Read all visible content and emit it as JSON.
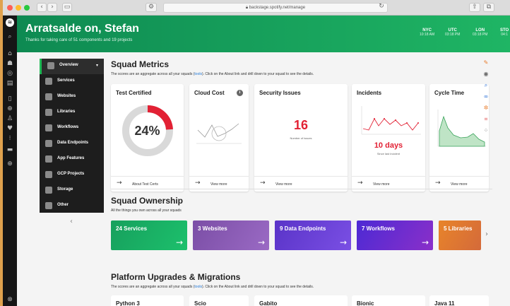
{
  "browser": {
    "url": "backstage.spotify.net/manage"
  },
  "header": {
    "title": "Arratsalde on, Stefan",
    "subtitle": "Thanks for taking care of 51 components and 19 projects",
    "clocks": [
      {
        "zone": "NYC",
        "time": "10:18 AM"
      },
      {
        "zone": "UTC",
        "time": "03:18 PM"
      },
      {
        "zone": "LON",
        "time": "03:18 PM"
      },
      {
        "zone": "STO",
        "time": "04:1"
      }
    ]
  },
  "menu": {
    "items": [
      {
        "label": "Overview",
        "active": true
      },
      {
        "label": "Services"
      },
      {
        "label": "Websites"
      },
      {
        "label": "Libraries"
      },
      {
        "label": "Workflows"
      },
      {
        "label": "Data Endpoints"
      },
      {
        "label": "App Features"
      },
      {
        "label": "GCP Projects"
      },
      {
        "label": "Storage"
      },
      {
        "label": "Other"
      }
    ],
    "collapse_glyph": "‹"
  },
  "metrics": {
    "title": "Squad Metrics",
    "subtitle_pre": "The scores are an aggregate across all your squads (",
    "subtitle_link": "tools",
    "subtitle_post": "). Click on the About link and drill down to your squad to see the details.",
    "cards": [
      {
        "title": "Test Certified",
        "value": "24%",
        "footer": "About Test Certs",
        "fill": 0.24
      },
      {
        "title": "Cloud Cost",
        "footer": "View more"
      },
      {
        "title": "Security Issues",
        "value": "16",
        "caption": "Number of issues",
        "footer": "View more"
      },
      {
        "title": "Incidents",
        "value": "10 days",
        "caption": "Since last incident",
        "footer": "View more"
      },
      {
        "title": "Cycle Time",
        "footer": "View more"
      }
    ]
  },
  "ownership": {
    "title": "Squad Ownership",
    "subtitle": "All the things you own across all your squads",
    "tiles": [
      {
        "label": "24 Services",
        "color": "#17a05d"
      },
      {
        "label": "3 Websites",
        "color": "#7b4ea6"
      },
      {
        "label": "9 Data Endpoints",
        "color": "#6a3fd6"
      },
      {
        "label": "7 Workflows",
        "color": "#6b2bd0"
      },
      {
        "label": "5 Libraries",
        "color": "#e8842a"
      }
    ]
  },
  "upgrades": {
    "title": "Platform Upgrades & Migrations",
    "subtitle_pre": "The scores are an aggregate across all your squads (",
    "subtitle_link": "tools",
    "subtitle_post": "). Click on the About link and drill down to your squad to see the details.",
    "cards": [
      "Python 3",
      "Scio",
      "Gabito",
      "Bionic",
      "Java 11"
    ]
  },
  "colors": {
    "accent": "#1db954",
    "danger": "#e22134"
  }
}
